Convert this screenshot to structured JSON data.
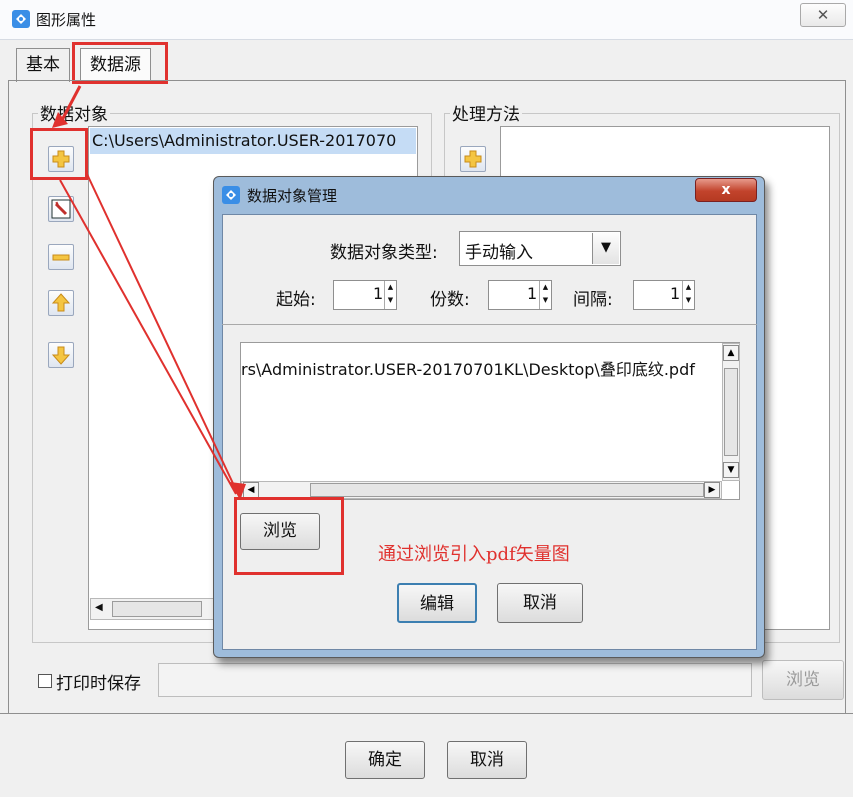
{
  "window": {
    "title": "图形属性",
    "close_label": "✕"
  },
  "tabs": [
    {
      "label": "基本"
    },
    {
      "label": "数据源"
    }
  ],
  "data_objects": {
    "group_title": "数据对象",
    "item": "C:\\Users\\Administrator.USER-2017070"
  },
  "process": {
    "group_title": "处理方法"
  },
  "print_save": {
    "label": "打印时保存",
    "browse_label": "浏览"
  },
  "footer": {
    "ok_label": "确定",
    "cancel_label": "取消"
  },
  "dialog": {
    "title": "数据对象管理",
    "close_label": "x",
    "type_label": "数据对象类型:",
    "type_value": "手动输入",
    "start_label": "起始:",
    "start_value": "1",
    "copies_label": "份数:",
    "copies_value": "1",
    "interval_label": "间隔:",
    "interval_value": "1",
    "path_text": "rs\\Administrator.USER-20170701KL\\Desktop\\叠印底纹.pdf",
    "browse_label": "浏览",
    "annotation": "通过浏览引入pdf矢量图",
    "edit_label": "编辑",
    "cancel_label": "取消"
  },
  "colors": {
    "annotation": "#e0312e",
    "dialog_frame": "#9ebcdb",
    "selection": "#c5dcf5"
  }
}
